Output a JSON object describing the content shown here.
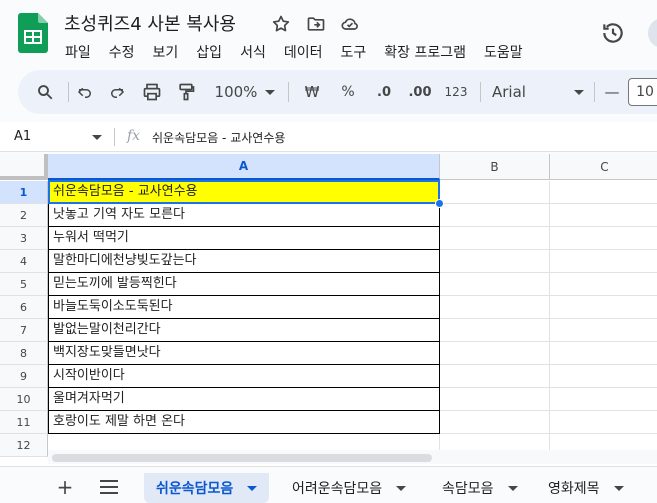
{
  "app": {
    "doc_title": "초성퀴즈4 사본 복사용",
    "colors": {
      "brand": "#0f9d58",
      "accent": "#0b57d0",
      "highlight": "#ffff00"
    }
  },
  "menu": [
    "파일",
    "수정",
    "보기",
    "삽입",
    "서식",
    "데이터",
    "도구",
    "확장 프로그램",
    "도움말"
  ],
  "title_icons": [
    "star-icon",
    "move-to-folder-icon",
    "cloud-saved-icon"
  ],
  "toolbar": {
    "zoom": "100%",
    "currency": "₩",
    "percent": "%",
    "decrease_decimal": ".0",
    "increase_decimal": ".00",
    "number_format": "123",
    "font": "Arial",
    "font_size": "10",
    "minus": "—"
  },
  "formula_bar": {
    "name_box": "A1",
    "fx": "fx",
    "content": "쉬운속담모음 - 교사연수용"
  },
  "grid": {
    "columns": [
      "A",
      "B",
      "C"
    ],
    "rows": [
      "1",
      "2",
      "3",
      "4",
      "5",
      "6",
      "7",
      "8",
      "9",
      "10",
      "11",
      "12"
    ],
    "colA": [
      "쉬운속담모음 - 교사연수용",
      "낫놓고 기역 자도 모른다",
      "누워서 떡먹기",
      "말한마디에천냥빚도갚는다",
      "믿는도끼에 발등찍힌다",
      "바늘도둑이소도둑된다",
      "발없는말이천리간다",
      "백지장도맞들면낫다",
      "시작이반이다",
      "울며겨자먹기",
      "호랑이도 제말 하면 온다",
      ""
    ],
    "selected_cell": "A1"
  },
  "sheets": {
    "add": "+",
    "all_sheets": "≡",
    "tabs": [
      "쉬운속담모음",
      "어려운속담모음",
      "속담모음",
      "영화제목"
    ],
    "active_index": 0
  }
}
